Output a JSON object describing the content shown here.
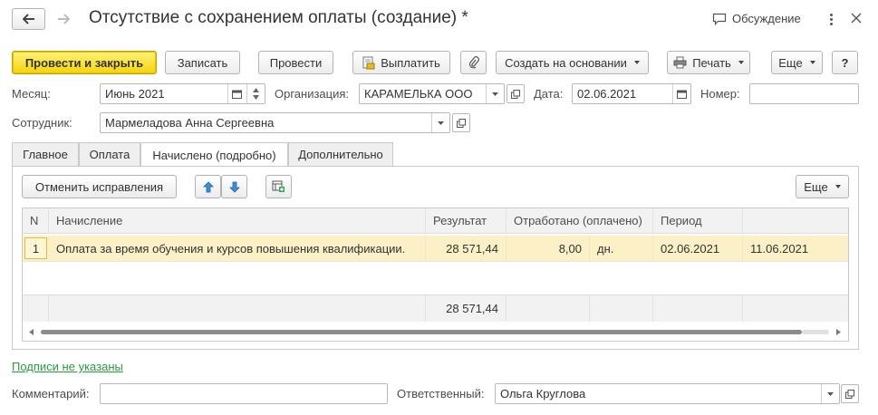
{
  "window": {
    "title": "Отсутствие с сохранением оплаты (создание) *",
    "discussion_label": "Обсуждение"
  },
  "toolbar": {
    "post_close_label": "Провести и закрыть",
    "save_label": "Записать",
    "post_label": "Провести",
    "pay_label": "Выплатить",
    "create_based_label": "Создать на основании",
    "print_label": "Печать",
    "more_label": "Еще",
    "help_label": "?"
  },
  "form": {
    "month_label": "Месяц:",
    "month_value": "Июнь 2021",
    "org_label": "Организация:",
    "org_value": "КАРАМЕЛЬКА ООО",
    "date_label": "Дата:",
    "date_value": "02.06.2021",
    "number_label": "Номер:",
    "number_value": "",
    "employee_label": "Сотрудник:",
    "employee_value": "Мармеладова Анна Сергеевна"
  },
  "tabs": [
    {
      "label": "Главное"
    },
    {
      "label": "Оплата"
    },
    {
      "label": "Начислено (подробно)"
    },
    {
      "label": "Дополнительно"
    }
  ],
  "table_toolbar": {
    "cancel_corrections_label": "Отменить исправления",
    "more_label": "Еще"
  },
  "table": {
    "columns": [
      "N",
      "Начисление",
      "Результат",
      "Отработано (оплачено)",
      "Период",
      ""
    ],
    "rows": [
      {
        "n": "1",
        "accrual": "Оплата за время обучения и курсов повышения квалификации.",
        "result": "28 571,44",
        "worked": "8,00",
        "unit": "дн.",
        "period_start": "02.06.2021",
        "period_end": "11.06.2021"
      }
    ],
    "footer_total": "28 571,44"
  },
  "footer": {
    "signatures_link": "Подписи не указаны",
    "comment_label": "Комментарий:",
    "comment_value": "",
    "responsible_label": "Ответственный:",
    "responsible_value": "Ольга Круглова"
  },
  "colors": {
    "primary_button": "#f5d30c",
    "selected_row": "#fbf0c6",
    "link": "#2a9d3f"
  }
}
